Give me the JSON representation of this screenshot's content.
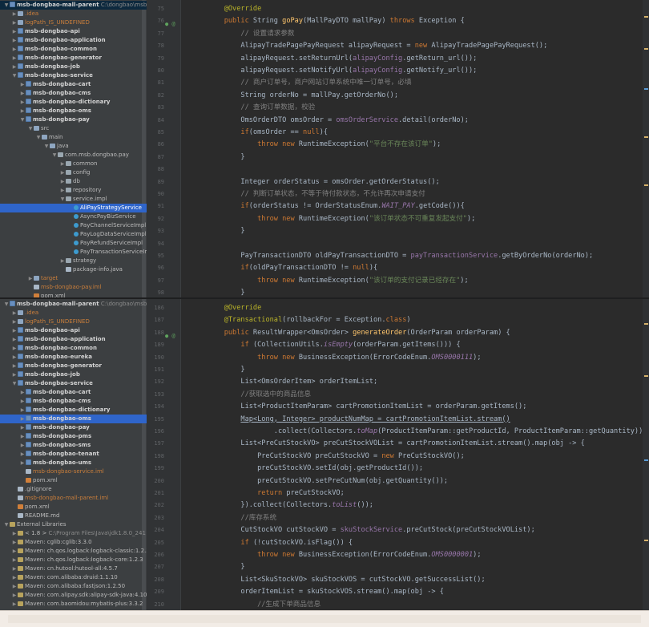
{
  "top": {
    "tree": [
      {
        "depth": 0,
        "arrow": "open",
        "icon": "module",
        "label": "msb-dongbao-mall-parent",
        "note": "C:\\dongbao\\msb-dongbao-mall-parent",
        "style": "b",
        "sel": "selected"
      },
      {
        "depth": 1,
        "arrow": "closed",
        "icon": "folder",
        "label": ".idea",
        "style": "orange"
      },
      {
        "depth": 1,
        "arrow": "closed",
        "icon": "folder",
        "label": "logPath_IS_UNDEFINED",
        "style": "orange"
      },
      {
        "depth": 1,
        "arrow": "closed",
        "icon": "module",
        "label": "msb-dongbao-api",
        "style": "b"
      },
      {
        "depth": 1,
        "arrow": "closed",
        "icon": "module",
        "label": "msb-dongbao-application",
        "style": "b"
      },
      {
        "depth": 1,
        "arrow": "closed",
        "icon": "module",
        "label": "msb-dongbao-common",
        "style": "b"
      },
      {
        "depth": 1,
        "arrow": "closed",
        "icon": "module",
        "label": "msb-dongbao-generator",
        "style": "b"
      },
      {
        "depth": 1,
        "arrow": "closed",
        "icon": "module",
        "label": "msb-dongbao-job",
        "style": "b"
      },
      {
        "depth": 1,
        "arrow": "open",
        "icon": "module",
        "label": "msb-dongbao-service",
        "style": "b"
      },
      {
        "depth": 2,
        "arrow": "closed",
        "icon": "module",
        "label": "msb-dongbao-cart",
        "style": "b"
      },
      {
        "depth": 2,
        "arrow": "closed",
        "icon": "module",
        "label": "msb-dongbao-cms",
        "style": "b"
      },
      {
        "depth": 2,
        "arrow": "closed",
        "icon": "module",
        "label": "msb-dongbao-dictionary",
        "style": "b"
      },
      {
        "depth": 2,
        "arrow": "closed",
        "icon": "module",
        "label": "msb-dongbao-oms",
        "style": "b"
      },
      {
        "depth": 2,
        "arrow": "open",
        "icon": "module",
        "label": "msb-dongbao-pay",
        "style": "b"
      },
      {
        "depth": 3,
        "arrow": "open",
        "icon": "folder",
        "label": "src"
      },
      {
        "depth": 4,
        "arrow": "open",
        "icon": "folder",
        "label": "main"
      },
      {
        "depth": 5,
        "arrow": "open",
        "icon": "folder",
        "label": "java"
      },
      {
        "depth": 6,
        "arrow": "open",
        "icon": "pkg",
        "label": "com.msb.dongbao.pay"
      },
      {
        "depth": 7,
        "arrow": "closed",
        "icon": "pkg",
        "label": "common"
      },
      {
        "depth": 7,
        "arrow": "closed",
        "icon": "pkg",
        "label": "config"
      },
      {
        "depth": 7,
        "arrow": "closed",
        "icon": "pkg",
        "label": "db"
      },
      {
        "depth": 7,
        "arrow": "closed",
        "icon": "pkg",
        "label": "repository"
      },
      {
        "depth": 7,
        "arrow": "open",
        "icon": "pkg",
        "label": "service.impl"
      },
      {
        "depth": 8,
        "arrow": "none",
        "icon": "java",
        "label": "AliPayStrategyService",
        "sel": "highlight"
      },
      {
        "depth": 8,
        "arrow": "none",
        "icon": "java",
        "label": "AsyncPayBizService"
      },
      {
        "depth": 8,
        "arrow": "none",
        "icon": "java",
        "label": "PayChannelServiceImpl"
      },
      {
        "depth": 8,
        "arrow": "none",
        "icon": "java",
        "label": "PayLogDataServiceImpl"
      },
      {
        "depth": 8,
        "arrow": "none",
        "icon": "java",
        "label": "PayRefundServiceImpl"
      },
      {
        "depth": 8,
        "arrow": "none",
        "icon": "java",
        "label": "PayTransactionServiceImpl"
      },
      {
        "depth": 7,
        "arrow": "closed",
        "icon": "pkg",
        "label": "strategy"
      },
      {
        "depth": 7,
        "arrow": "none",
        "icon": "file",
        "label": "package-info.java"
      },
      {
        "depth": 3,
        "arrow": "closed",
        "icon": "folder",
        "label": "target",
        "style": "orange"
      },
      {
        "depth": 3,
        "arrow": "none",
        "icon": "file",
        "label": "msb-dongbao-pay.iml",
        "style": "orange"
      },
      {
        "depth": 3,
        "arrow": "none",
        "icon": "xml",
        "label": "pom.xml"
      }
    ],
    "lines": [
      {
        "n": "75",
        "t": "    @Override",
        "cls": "an"
      },
      {
        "n": "76",
        "g": "o@",
        "segs": [
          [
            "    "
          ],
          [
            "public ",
            "k"
          ],
          [
            "String "
          ],
          [
            "goPay",
            "fn"
          ],
          [
            "(MallPayDTO mallPay) "
          ],
          [
            "throws ",
            "k"
          ],
          [
            "Exception {"
          ]
        ]
      },
      {
        "n": "77",
        "t": "        // 设置请求参数",
        "cls": "c"
      },
      {
        "n": "78",
        "segs": [
          [
            "        AlipayTradePagePayRequest alipayRequest = "
          ],
          [
            "new ",
            "k"
          ],
          [
            "AlipayTradePagePayRequest();"
          ]
        ]
      },
      {
        "n": "79",
        "segs": [
          [
            "        alipayRequest.setReturnUrl("
          ],
          [
            "alipayConfig",
            "fld"
          ],
          [
            ".getReturn_url());"
          ]
        ]
      },
      {
        "n": "80",
        "segs": [
          [
            "        alipayRequest.setNotifyUrl("
          ],
          [
            "alipayConfig",
            "fld"
          ],
          [
            ".getNotify_url());"
          ]
        ]
      },
      {
        "n": "81",
        "t": "        // 商户订单号，商户网站订单系统中唯一订单号，必填",
        "cls": "c"
      },
      {
        "n": "82",
        "t": "        String orderNo = mallPay.getOrderNo();"
      },
      {
        "n": "83",
        "t": "        // 查询订单数据，校验",
        "cls": "c"
      },
      {
        "n": "84",
        "segs": [
          [
            "        OmsOrderDTO omsOrder = "
          ],
          [
            "omsOrderService",
            "fld"
          ],
          [
            ".detail(orderNo);"
          ]
        ]
      },
      {
        "n": "85",
        "segs": [
          [
            "        "
          ],
          [
            "if",
            "k"
          ],
          [
            "(omsOrder == "
          ],
          [
            "null",
            "k"
          ],
          [
            "){"
          ]
        ]
      },
      {
        "n": "86",
        "segs": [
          [
            "            "
          ],
          [
            "throw new ",
            "k"
          ],
          [
            "RuntimeException("
          ],
          [
            "\"平台不存在该订单\"",
            "s"
          ],
          [
            ");"
          ]
        ]
      },
      {
        "n": "87",
        "t": "        }"
      },
      {
        "n": "88",
        "t": ""
      },
      {
        "n": "89",
        "t": "        Integer orderStatus = omsOrder.getOrderStatus();"
      },
      {
        "n": "90",
        "t": "        // 判断订单状态，不等于待付款状态，不允许再次申请支付",
        "cls": "c"
      },
      {
        "n": "91",
        "segs": [
          [
            "        "
          ],
          [
            "if",
            "k"
          ],
          [
            "(orderStatus != OrderStatusEnum."
          ],
          [
            "WAIT_PAY",
            "st"
          ],
          [
            ".getCode()){"
          ]
        ]
      },
      {
        "n": "92",
        "segs": [
          [
            "            "
          ],
          [
            "throw new ",
            "k"
          ],
          [
            "RuntimeException("
          ],
          [
            "\"该订单状态不可重复发起支付\"",
            "s"
          ],
          [
            ");"
          ]
        ]
      },
      {
        "n": "93",
        "t": "        }"
      },
      {
        "n": "94",
        "t": ""
      },
      {
        "n": "95",
        "segs": [
          [
            "        PayTransactionDTO oldPayTransactionDTO = "
          ],
          [
            "payTransactionService",
            "fld"
          ],
          [
            ".getByOrderNo(orderNo);"
          ]
        ]
      },
      {
        "n": "96",
        "segs": [
          [
            "        "
          ],
          [
            "if",
            "k"
          ],
          [
            "(oldPayTransactionDTO != "
          ],
          [
            "null",
            "k"
          ],
          [
            "){"
          ]
        ]
      },
      {
        "n": "97",
        "segs": [
          [
            "            "
          ],
          [
            "throw new ",
            "k"
          ],
          [
            "RuntimeException("
          ],
          [
            "\"该订单的支付记录已经存在\"",
            "s"
          ],
          [
            ");"
          ]
        ]
      },
      {
        "n": "98",
        "t": "        }"
      }
    ]
  },
  "bottom": {
    "tree": [
      {
        "depth": 0,
        "arrow": "open",
        "icon": "module",
        "label": "msb-dongbao-mall-parent",
        "note": "C:\\dongbao\\msb-dongbao-mall-parent",
        "style": "b"
      },
      {
        "depth": 1,
        "arrow": "closed",
        "icon": "folder",
        "label": ".idea",
        "style": "orange"
      },
      {
        "depth": 1,
        "arrow": "closed",
        "icon": "folder",
        "label": "logPath_IS_UNDEFINED",
        "style": "orange"
      },
      {
        "depth": 1,
        "arrow": "closed",
        "icon": "module",
        "label": "msb-dongbao-api",
        "style": "b"
      },
      {
        "depth": 1,
        "arrow": "closed",
        "icon": "module",
        "label": "msb-dongbao-application",
        "style": "b"
      },
      {
        "depth": 1,
        "arrow": "closed",
        "icon": "module",
        "label": "msb-dongbao-common",
        "style": "b"
      },
      {
        "depth": 1,
        "arrow": "closed",
        "icon": "module",
        "label": "msb-dongbao-eureka",
        "style": "b"
      },
      {
        "depth": 1,
        "arrow": "closed",
        "icon": "module",
        "label": "msb-dongbao-generator",
        "style": "b"
      },
      {
        "depth": 1,
        "arrow": "closed",
        "icon": "module",
        "label": "msb-dongbao-job",
        "style": "b"
      },
      {
        "depth": 1,
        "arrow": "open",
        "icon": "module",
        "label": "msb-dongbao-service",
        "style": "b"
      },
      {
        "depth": 2,
        "arrow": "closed",
        "icon": "module",
        "label": "msb-dongbao-cart",
        "style": "b"
      },
      {
        "depth": 2,
        "arrow": "closed",
        "icon": "module",
        "label": "msb-dongbao-cms",
        "style": "b"
      },
      {
        "depth": 2,
        "arrow": "closed",
        "icon": "module",
        "label": "msb-dongbao-dictionary",
        "style": "b"
      },
      {
        "depth": 2,
        "arrow": "closed",
        "icon": "module",
        "label": "msb-dongbao-oms",
        "style": "b",
        "sel": "highlight"
      },
      {
        "depth": 2,
        "arrow": "closed",
        "icon": "module",
        "label": "msb-dongbao-pay",
        "style": "b"
      },
      {
        "depth": 2,
        "arrow": "closed",
        "icon": "module",
        "label": "msb-dongbao-pms",
        "style": "b"
      },
      {
        "depth": 2,
        "arrow": "closed",
        "icon": "module",
        "label": "msb-dongbao-sms",
        "style": "b"
      },
      {
        "depth": 2,
        "arrow": "closed",
        "icon": "module",
        "label": "msb-dongbao-tenant",
        "style": "b"
      },
      {
        "depth": 2,
        "arrow": "closed",
        "icon": "module",
        "label": "msb-dongbao-ums",
        "style": "b"
      },
      {
        "depth": 2,
        "arrow": "none",
        "icon": "file",
        "label": "msb-dongbao-service.iml",
        "style": "orange"
      },
      {
        "depth": 2,
        "arrow": "none",
        "icon": "xml",
        "label": "pom.xml"
      },
      {
        "depth": 1,
        "arrow": "none",
        "icon": "file",
        "label": ".gitignore"
      },
      {
        "depth": 1,
        "arrow": "none",
        "icon": "file",
        "label": "msb-dongbao-mall-parent.iml",
        "style": "orange"
      },
      {
        "depth": 1,
        "arrow": "none",
        "icon": "xml",
        "label": "pom.xml"
      },
      {
        "depth": 1,
        "arrow": "none",
        "icon": "file",
        "label": "README.md"
      },
      {
        "depth": 0,
        "arrow": "open",
        "icon": "lib",
        "label": "External Libraries"
      },
      {
        "depth": 1,
        "arrow": "closed",
        "icon": "lib",
        "label": "< 1.8 >",
        "note": "C:\\Program Files\\Java\\jdk1.8.0_241"
      },
      {
        "depth": 1,
        "arrow": "closed",
        "icon": "lib",
        "label": "Maven: cglib:cglib:3.3.0"
      },
      {
        "depth": 1,
        "arrow": "closed",
        "icon": "lib",
        "label": "Maven: ch.qos.logback:logback-classic:1.2.3"
      },
      {
        "depth": 1,
        "arrow": "closed",
        "icon": "lib",
        "label": "Maven: ch.qos.logback:logback-core:1.2.3"
      },
      {
        "depth": 1,
        "arrow": "closed",
        "icon": "lib",
        "label": "Maven: cn.hutool:hutool-all:4.5.7"
      },
      {
        "depth": 1,
        "arrow": "closed",
        "icon": "lib",
        "label": "Maven: com.alibaba:druid:1.1.10"
      },
      {
        "depth": 1,
        "arrow": "closed",
        "icon": "lib",
        "label": "Maven: com.alibaba:fastjson:1.2.50"
      },
      {
        "depth": 1,
        "arrow": "closed",
        "icon": "lib",
        "label": "Maven: com.alipay.sdk:alipay-sdk-java:4.10.0.ALL"
      },
      {
        "depth": 1,
        "arrow": "closed",
        "icon": "lib",
        "label": "Maven: com.baomidou:mybatis-plus:3.3.2"
      }
    ],
    "lines": [
      {
        "n": "186",
        "t": "    @Override",
        "cls": "an"
      },
      {
        "n": "187",
        "segs": [
          [
            "    "
          ],
          [
            "@Transactional",
            "an"
          ],
          [
            "(rollbackFor = Exception."
          ],
          [
            "class",
            "k"
          ],
          [
            ")"
          ]
        ]
      },
      {
        "n": "188",
        "g": "o@",
        "segs": [
          [
            "    "
          ],
          [
            "public ",
            "k"
          ],
          [
            "ResultWrapper<OmsOrder> "
          ],
          [
            "generateOrder",
            "fn"
          ],
          [
            "(OrderParam orderParam) {"
          ]
        ]
      },
      {
        "n": "189",
        "segs": [
          [
            "        "
          ],
          [
            "if ",
            "k"
          ],
          [
            "(CollectionUtils."
          ],
          [
            "isEmpty",
            "st"
          ],
          [
            "(orderParam.getItems())) {"
          ]
        ]
      },
      {
        "n": "190",
        "segs": [
          [
            "            "
          ],
          [
            "throw new ",
            "k"
          ],
          [
            "BusinessException(ErrorCodeEnum."
          ],
          [
            "OMS0000111",
            "st"
          ],
          [
            ");"
          ]
        ]
      },
      {
        "n": "191",
        "t": "        }"
      },
      {
        "n": "192",
        "t": "        List<OmsOrderItem> orderItemList;"
      },
      {
        "n": "193",
        "t": "        //获取选中的商品信息",
        "cls": "c"
      },
      {
        "n": "194",
        "t": "        List<ProductItemParam> cartPromotionItemList = orderParam.getItems();"
      },
      {
        "n": "195",
        "segs": [
          [
            "        "
          ],
          [
            "Map<Long, Integer> productNumMap = cartPromotionItemList.stream()",
            "u"
          ]
        ]
      },
      {
        "n": "196",
        "segs": [
          [
            "                .collect(Collectors."
          ],
          [
            "toMap",
            "st"
          ],
          [
            "(ProductItemParam::getProductId, ProductItemParam::getQuantity));"
          ]
        ]
      },
      {
        "n": "197",
        "t": "        List<PreCutStockVO> preCutStockVOList = cartPromotionItemList.stream().map(obj -> {"
      },
      {
        "n": "198",
        "segs": [
          [
            "            PreCutStockVO preCutStockVO = "
          ],
          [
            "new ",
            "k"
          ],
          [
            "PreCutStockVO();"
          ]
        ]
      },
      {
        "n": "199",
        "t": "            preCutStockVO.setId(obj.getProductId());"
      },
      {
        "n": "200",
        "t": "            preCutStockVO.setPreCutNum(obj.getQuantity());"
      },
      {
        "n": "201",
        "segs": [
          [
            "            "
          ],
          [
            "return ",
            "k"
          ],
          [
            "preCutStockVO;"
          ]
        ]
      },
      {
        "n": "202",
        "segs": [
          [
            "        }).collect(Collectors."
          ],
          [
            "toList",
            "st"
          ],
          [
            "());"
          ]
        ]
      },
      {
        "n": "203",
        "t": "        //库存系统",
        "cls": "c"
      },
      {
        "n": "204",
        "segs": [
          [
            "        CutStockVO cutStockVO = "
          ],
          [
            "skuStockService",
            "fld"
          ],
          [
            ".preCutStock(preCutStockVOList);"
          ]
        ]
      },
      {
        "n": "205",
        "segs": [
          [
            "        "
          ],
          [
            "if ",
            "k"
          ],
          [
            "(!cutStockVO.isFlag()) {"
          ]
        ]
      },
      {
        "n": "206",
        "segs": [
          [
            "            "
          ],
          [
            "throw new ",
            "k"
          ],
          [
            "BusinessException(ErrorCodeEnum."
          ],
          [
            "OMS0000001",
            "st"
          ],
          [
            ");"
          ]
        ]
      },
      {
        "n": "207",
        "t": "        }"
      },
      {
        "n": "208",
        "t": "        List<SkuStockVO> skuStockVOS = cutStockVO.getSuccessList();"
      },
      {
        "n": "209",
        "t": "        orderItemList = skuStockVOS.stream().map(obj -> {"
      },
      {
        "n": "210",
        "t": "            //生成下单商品信息",
        "cls": "c"
      }
    ]
  }
}
